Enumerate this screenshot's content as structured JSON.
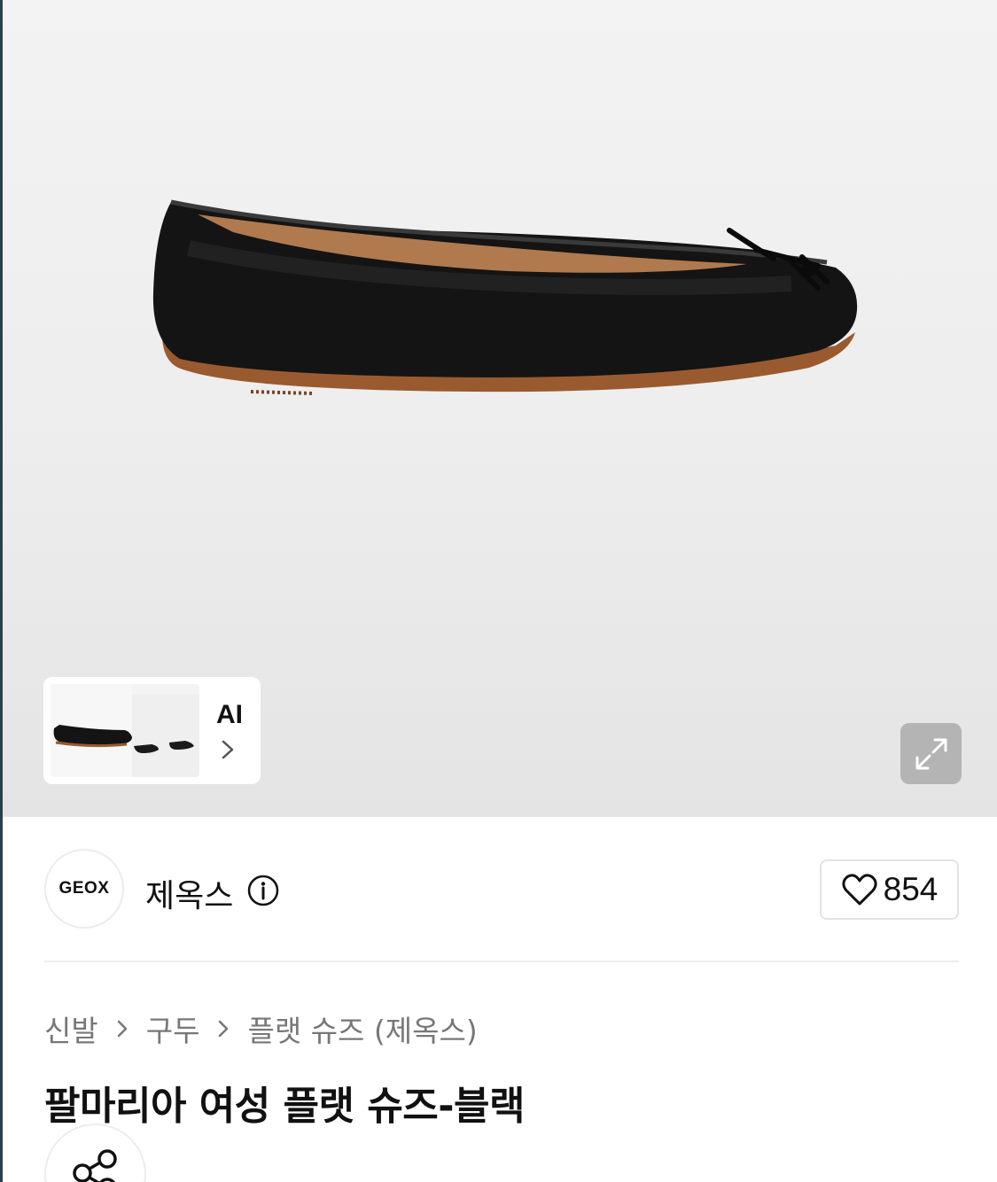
{
  "gallery": {
    "thumbnail_ai_label": "AI"
  },
  "brand": {
    "logo_text": "GEOX",
    "name": "제옥스"
  },
  "like": {
    "count": "854"
  },
  "breadcrumb": [
    {
      "label": "신발"
    },
    {
      "label": "구두"
    },
    {
      "label": "플랫 슈즈 (제옥스)"
    }
  ],
  "product": {
    "title": "팔마리아 여성 플랫 슈즈-블랙"
  },
  "icons": {
    "expand": "expand-icon",
    "info": "info-icon",
    "heart": "heart-icon",
    "share": "share-icon",
    "chevron": "chevron-right-icon"
  },
  "colors": {
    "hero_background": "#eeeeee",
    "expand_button": "#b4b4b4",
    "breadcrumb_text": "#777777"
  }
}
